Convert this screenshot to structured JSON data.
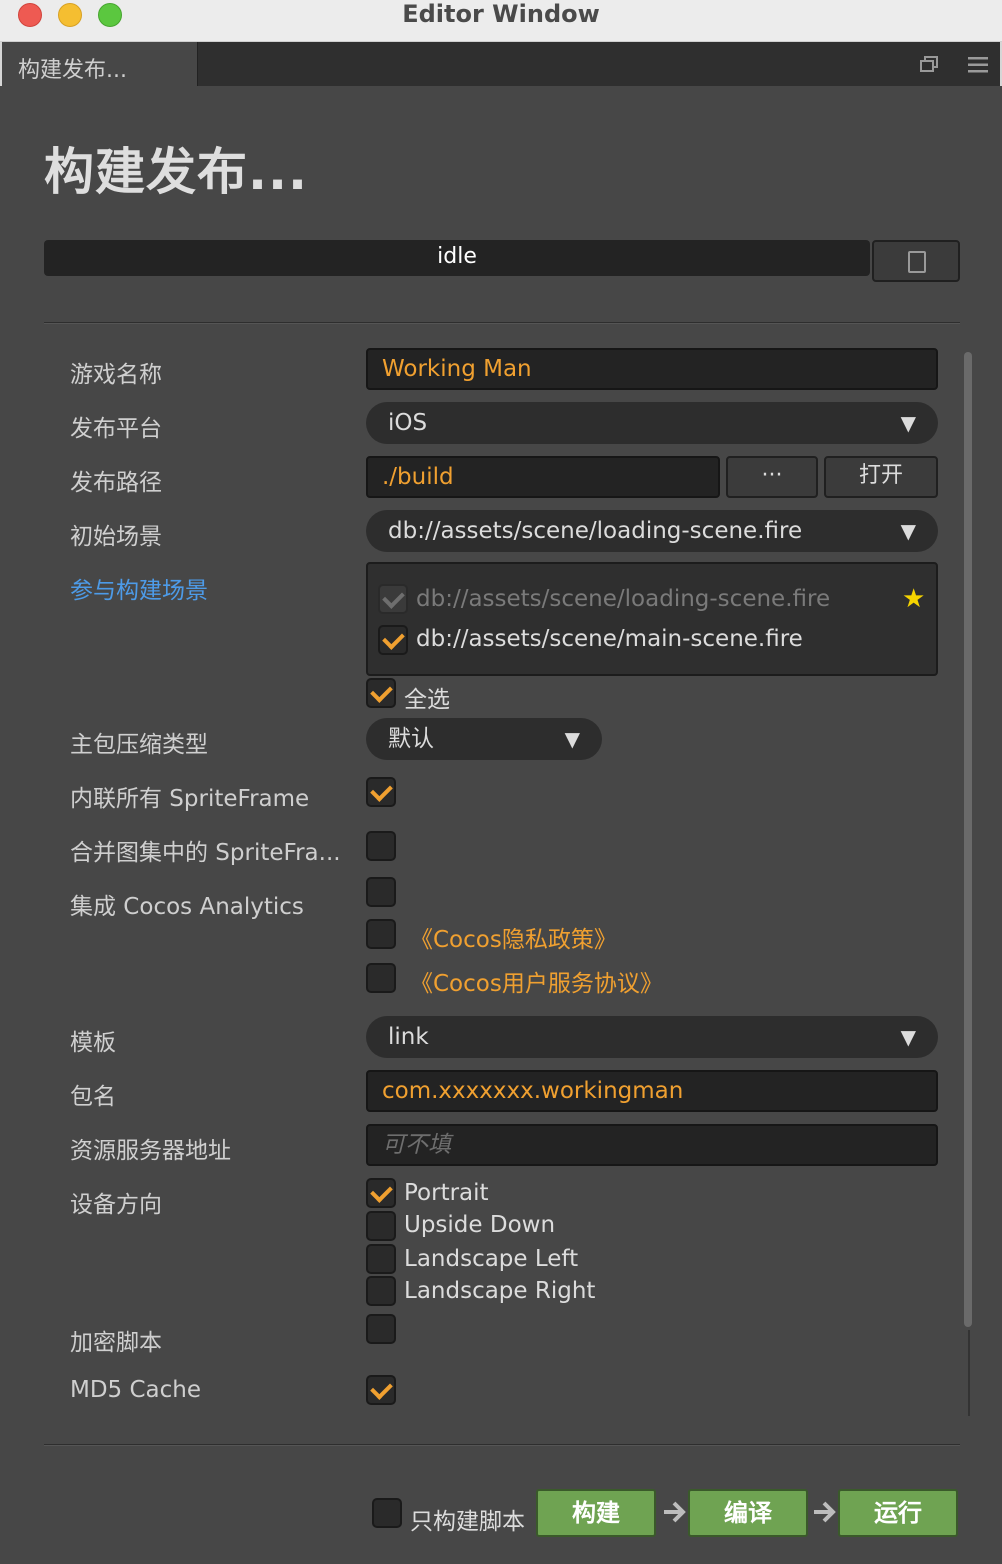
{
  "window": {
    "title": "Editor Window"
  },
  "tab": {
    "label": "构建发布..."
  },
  "page": {
    "title": "构建发布..."
  },
  "status": {
    "text": "idle"
  },
  "fields": {
    "game_name": {
      "label": "游戏名称",
      "value": "Working Man"
    },
    "platform": {
      "label": "发布平台",
      "value": "iOS"
    },
    "build_path": {
      "label": "发布路径",
      "value": "./build",
      "browse_label": "···",
      "open_label": "打开"
    },
    "start_scene": {
      "label": "初始场景",
      "value": "db://assets/scene/loading-scene.fire"
    },
    "included_scenes": {
      "label": "参与构建场景",
      "items": [
        {
          "path": "db://assets/scene/loading-scene.fire",
          "checked": true,
          "disabled": true,
          "start": true
        },
        {
          "path": "db://assets/scene/main-scene.fire",
          "checked": true,
          "disabled": false,
          "start": false
        }
      ],
      "select_all_label": "全选"
    },
    "compression": {
      "label": "主包压缩类型",
      "value": "默认"
    },
    "inline_spriteframe": {
      "label": "内联所有 SpriteFrame",
      "checked": true
    },
    "merge_spriteframe": {
      "label": "合并图集中的 SpriteFra...",
      "checked": false
    },
    "analytics": {
      "label": "集成 Cocos Analytics",
      "checked": false,
      "privacy_label": "《Cocos隐私政策》",
      "terms_label": "《Cocos用户服务协议》"
    },
    "template": {
      "label": "模板",
      "value": "link"
    },
    "package_name": {
      "label": "包名",
      "value": "com.xxxxxxx.workingman"
    },
    "resource_server": {
      "label": "资源服务器地址",
      "placeholder": "可不填"
    },
    "orientation": {
      "label": "设备方向",
      "options": [
        {
          "label": "Portrait",
          "checked": true
        },
        {
          "label": "Upside Down",
          "checked": false
        },
        {
          "label": "Landscape Left",
          "checked": false
        },
        {
          "label": "Landscape Right",
          "checked": false
        }
      ]
    },
    "encrypt_js": {
      "label": "加密脚本",
      "checked": false
    },
    "md5_cache": {
      "label": "MD5 Cache",
      "checked": true
    }
  },
  "footer": {
    "scripts_only_label": "只构建脚本",
    "build_label": "构建",
    "compile_label": "编译",
    "run_label": "运行"
  },
  "colors": {
    "accent": "#f0a030",
    "link": "#4d9be8",
    "action_green": "#6fa352",
    "panel_bg": "#474747"
  }
}
